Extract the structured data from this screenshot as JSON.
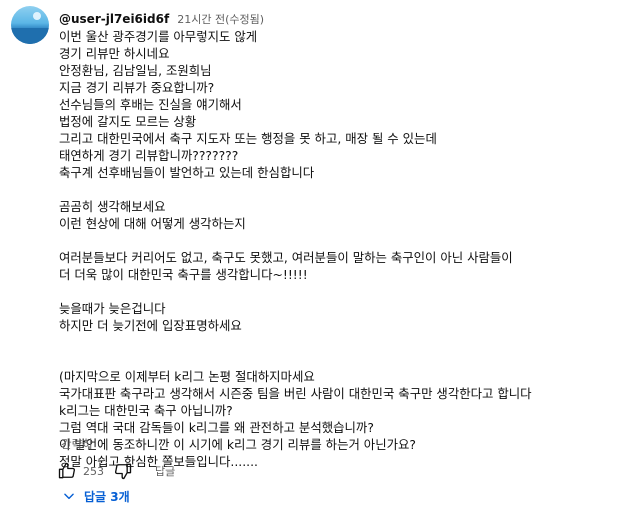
{
  "comment": {
    "avatar_icon": "channel-avatar",
    "handle": "@user-jl7ei6id6f",
    "time": "21시간 전(수정됨)",
    "lines": [
      "이번 울산 광주경기를 아무렇지도 않게",
      "경기 리뷰만 하시네요",
      "안정환님, 김남일님, 조원희님",
      "지금 경기 리뷰가 중요합니까?",
      "선수님들의 후배는 진실을 얘기해서",
      "법정에 갈지도 모르는 상황",
      "그리고 대한민국에서 축구 지도자 또는 행정을 못 하고, 매장 될 수 있는데",
      "태연하게 경기 리뷰합니까???????",
      "축구계 선후배님들이 발언하고 있는데 한심합니다",
      "",
      "곰곰히 생각해보세요",
      "이런 현상에 대해 어떻게 생각하는지",
      "",
      "여러분들보다 커리어도 없고, 축구도 못했고, 여러분들이 말하는 축구인이 아닌 사람들이",
      "더 더욱 많이 대한민국 축구를 생각합니다~!!!!!",
      "",
      "늦을때가 늦은겁니다",
      "하지만 더 늦기전에 입장표명하세요",
      "",
      "",
      "(마지막으로 이제부터 k리그 논평 절대하지마세요",
      "국가대표판 축구라고 생각해서 시즌중 팀을 버린 사람이 대한민국 축구만 생각한다고 합니다",
      "k리그는 대한민국 축구 아닙니까?",
      "그럼 역대 국대 감독들이 k리그를 왜 관전하고 분석했습니까?",
      "이 발언에 동조하니깐 이 시기에 k리그 경기 리뷰를 하는거 아닌가요?",
      "정말 아쉽고 한심한 쫄보들입니다......."
    ],
    "show_less": "간략히",
    "like_count": "253",
    "reply_label": "답글",
    "replies_label": "답글 3개"
  },
  "colors": {
    "text": "#0f0f0f",
    "secondary": "#606060",
    "link_blue": "#065fd4"
  }
}
